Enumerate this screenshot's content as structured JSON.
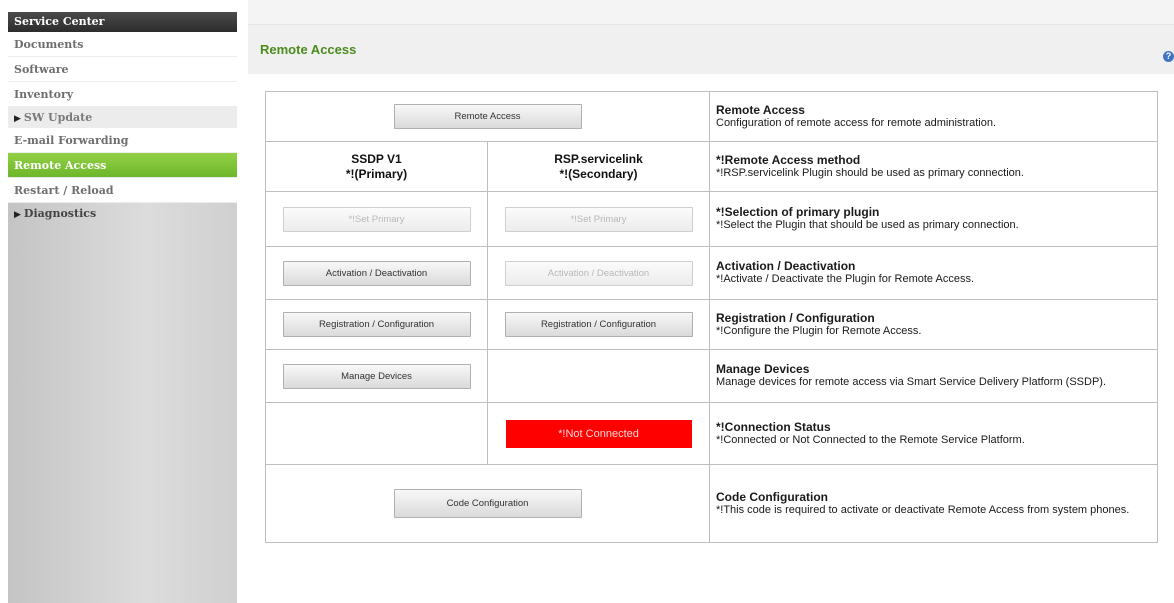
{
  "sidebar": {
    "header": "Service Center",
    "items": [
      {
        "label": "Documents"
      },
      {
        "label": "Software"
      },
      {
        "label": "Inventory"
      },
      {
        "label": "SW Update"
      },
      {
        "label": "E-mail Forwarding"
      },
      {
        "label": "Remote Access"
      },
      {
        "label": "Restart / Reload"
      },
      {
        "label": "Diagnostics"
      }
    ]
  },
  "main": {
    "section_title": "Remote Access",
    "help_icon": "?"
  },
  "table": {
    "rows": [
      {
        "button": "Remote Access",
        "desc_title": "Remote Access",
        "desc": "Configuration of remote access for remote administration."
      },
      {
        "col1": [
          "SSDP V1",
          "*!(Primary)"
        ],
        "col2": [
          "RSP.servicelink",
          "*!(Secondary)"
        ],
        "desc_title": "*!Remote Access method",
        "desc": "*!RSP.servicelink Plugin should be used as primary connection."
      },
      {
        "button1": "*!Set Primary",
        "button2": "*!Set Primary",
        "desc_title": "*!Selection of primary plugin",
        "desc": "*!Select the Plugin that should be used as primary connection."
      },
      {
        "button1": "Activation / Deactivation",
        "button2": "Activation / Deactivation",
        "desc_title": "Activation / Deactivation",
        "desc": "*!Activate / Deactivate the Plugin for Remote Access."
      },
      {
        "button1": "Registration / Configuration",
        "button2": "Registration / Configuration",
        "desc_title": "Registration / Configuration",
        "desc": "*!Configure the Plugin for Remote Access."
      },
      {
        "button1": "Manage Devices",
        "desc_title": "Manage Devices",
        "desc": "Manage devices for remote access via Smart Service Delivery Platform (SSDP)."
      },
      {
        "status": "*!Not Connected",
        "desc_title": "*!Connection Status",
        "desc": "*!Connected or Not Connected to the Remote Service Platform."
      },
      {
        "button": "Code Configuration",
        "desc_title": "Code Configuration",
        "desc": "*!This code is required to activate or deactivate Remote Access from system phones."
      }
    ]
  },
  "colors": {
    "active_nav": "#7cc236",
    "section_title": "#4c8b1d",
    "status_not_connected": "#ff0000"
  }
}
